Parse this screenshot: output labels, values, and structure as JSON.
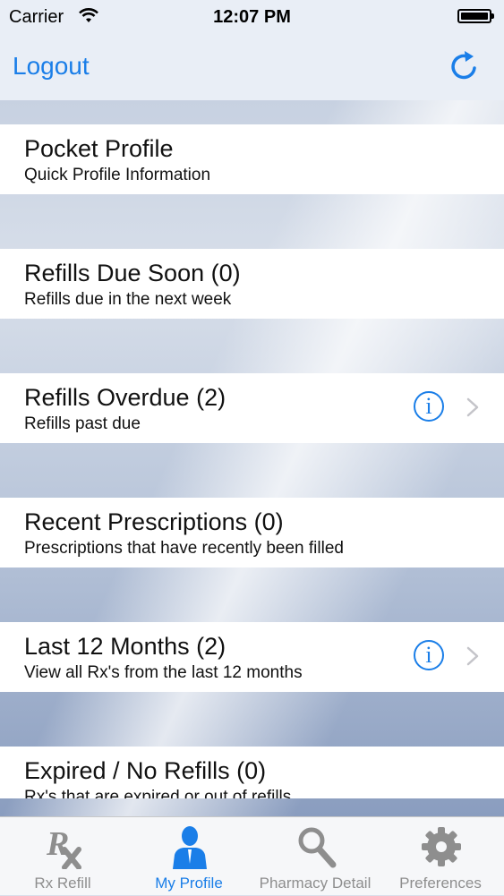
{
  "status_bar": {
    "carrier": "Carrier",
    "time": "12:07 PM"
  },
  "nav": {
    "logout_label": "Logout"
  },
  "rows": [
    {
      "title": "Pocket Profile",
      "subtitle": "Quick Profile Information"
    },
    {
      "title": "Refills Due Soon (0)",
      "subtitle": "Refills due in the next week"
    },
    {
      "title": "Refills Overdue (2)",
      "subtitle": "Refills past due"
    },
    {
      "title": "Recent Prescriptions (0)",
      "subtitle": "Prescriptions that have recently been filled"
    },
    {
      "title": "Last 12 Months (2)",
      "subtitle": "View all Rx's from the last 12 months"
    },
    {
      "title": "Expired / No Refills (0)",
      "subtitle": "Rx's that are expired or out of refills"
    }
  ],
  "tabs": [
    {
      "label": "Rx Refill"
    },
    {
      "label": "My Profile"
    },
    {
      "label": "Pharmacy Detail"
    },
    {
      "label": "Preferences"
    }
  ],
  "colors": {
    "accent": "#1a7ee8",
    "tab_inactive": "#8e8e8e"
  }
}
